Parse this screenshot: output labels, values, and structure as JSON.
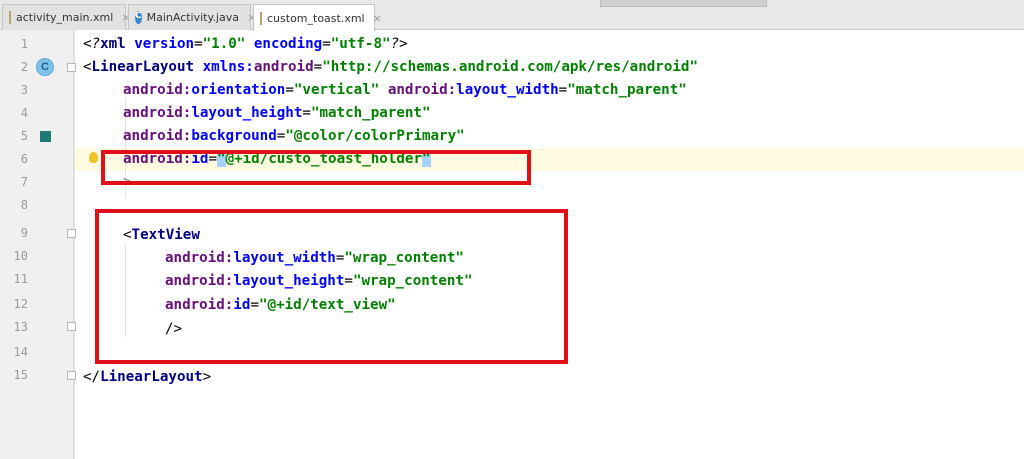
{
  "tabs": [
    {
      "label": "activity_main.xml",
      "icon": "xml-file-icon",
      "active": false
    },
    {
      "label": "MainActivity.java",
      "icon": "java-class-icon",
      "active": false
    },
    {
      "label": "custom_toast.xml",
      "icon": "xml-file-icon",
      "active": true
    }
  ],
  "tab_close_glyph": "×",
  "gutter": {
    "line_numbers": [
      "1",
      "2",
      "3",
      "4",
      "5",
      "6",
      "7",
      "8",
      "9",
      "10",
      "11",
      "12",
      "13",
      "14",
      "15"
    ],
    "class_icon_letter": "C",
    "color_swatch": "#1f7a73"
  },
  "code": {
    "l1": {
      "open": "<?",
      "tag": "xml ",
      "a1": "version",
      "eq1": "=",
      "v1": "\"1.0\" ",
      "a2": "encoding",
      "eq2": "=",
      "v2": "\"utf-8\"",
      "close": "?>"
    },
    "l2": {
      "open": "<",
      "tag": "LinearLayout ",
      "ns": "xmlns:",
      "attr": "android",
      "eq": "=",
      "val": "\"http://schemas.android.com/apk/res/android\""
    },
    "l3": {
      "ns1": "android:",
      "a1": "orientation",
      "eq1": "=",
      "v1": "\"vertical\" ",
      "ns2": "android:",
      "a2": "layout_width",
      "eq2": "=",
      "v2": "\"match_parent\""
    },
    "l4": {
      "ns": "android:",
      "attr": "layout_height",
      "eq": "=",
      "val": "\"match_parent\""
    },
    "l5": {
      "ns": "android:",
      "attr": "background",
      "eq": "=",
      "val": "\"@color/colorPrimary\""
    },
    "l6": {
      "ns": "android:",
      "attr": "id",
      "eq": "=",
      "q1": "\"",
      "val": "@+id/custo_toast_holder",
      "q2": "\""
    },
    "l7": {
      "text": ">"
    },
    "l9": {
      "open": "<",
      "tag": "TextView"
    },
    "l10": {
      "ns": "android:",
      "attr": "layout_width",
      "eq": "=",
      "val": "\"wrap_content\""
    },
    "l11": {
      "ns": "android:",
      "attr": "layout_height",
      "eq": "=",
      "val": "\"wrap_content\""
    },
    "l12": {
      "ns": "android:",
      "attr": "id",
      "eq": "=",
      "val": "\"@+id/text_view\""
    },
    "l13": {
      "text": "/>"
    },
    "l15": {
      "open": "</",
      "tag": "LinearLayout",
      "close": ">"
    }
  },
  "colors": {
    "annotation_red": "#e0101a",
    "current_line": "#fffbe0",
    "selection": "#a6d2ff"
  }
}
